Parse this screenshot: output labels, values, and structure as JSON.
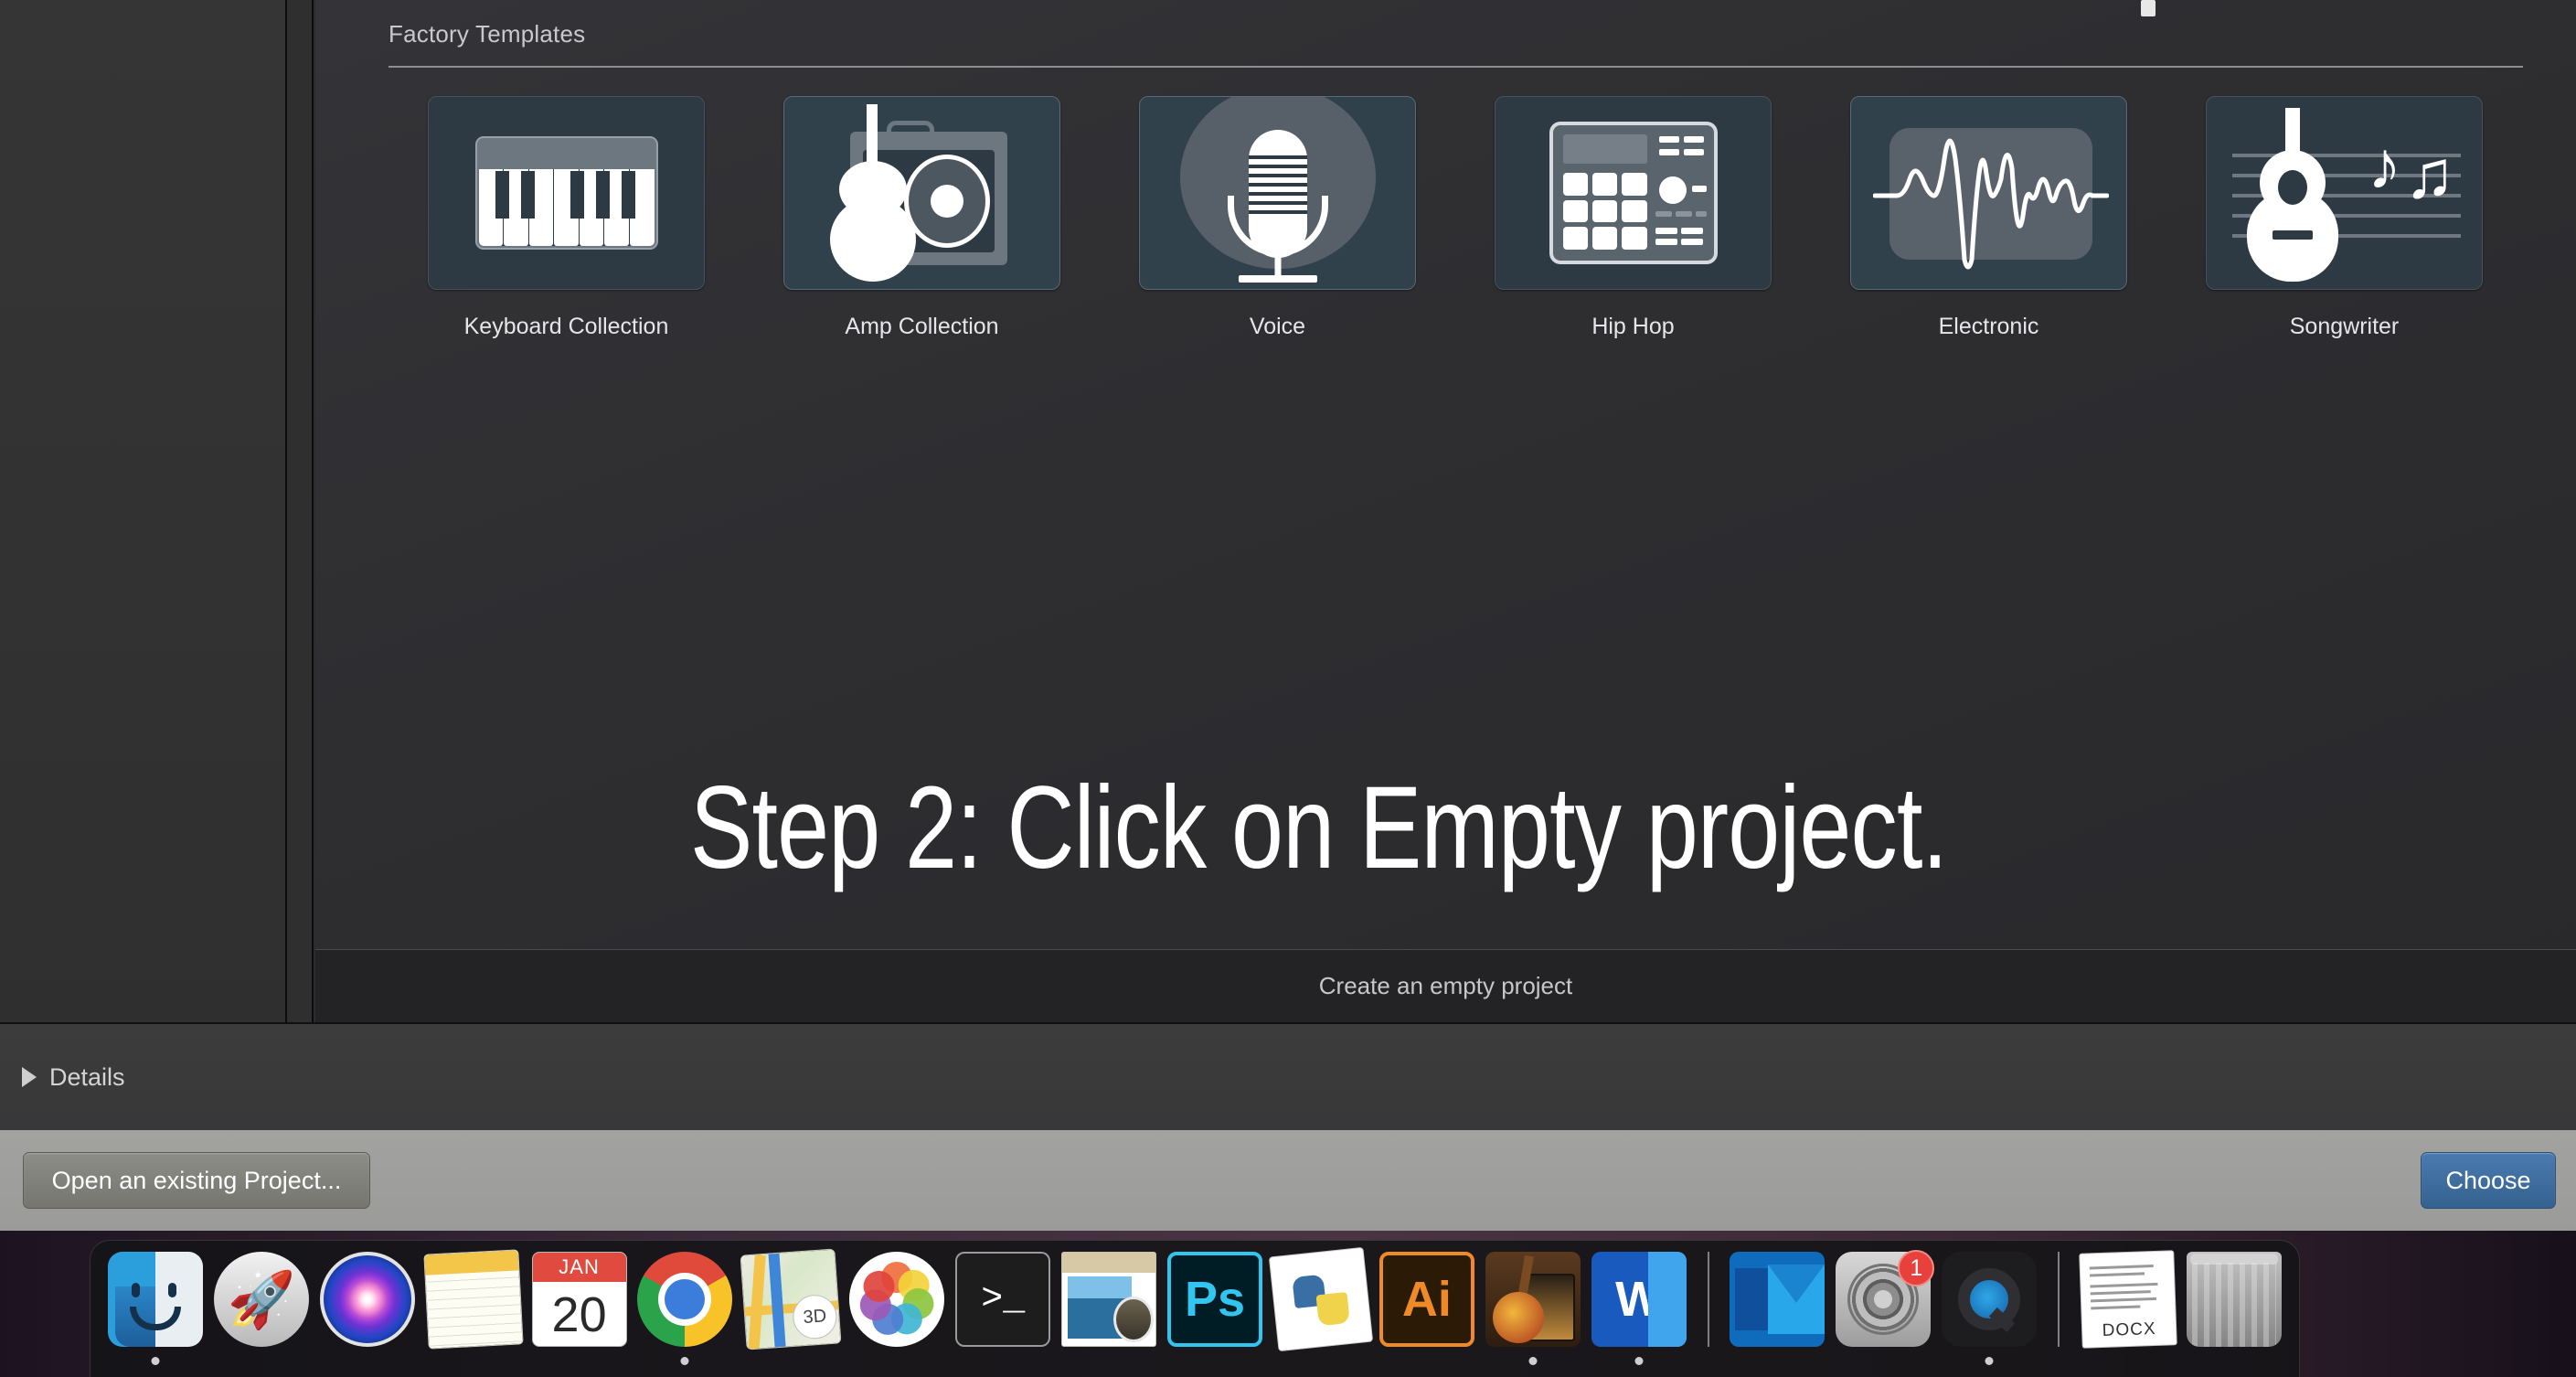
{
  "chooser": {
    "section_title": "Factory Templates",
    "templates": [
      {
        "label": "Keyboard Collection",
        "icon": "piano-keyboard-icon",
        "selected": false
      },
      {
        "label": "Amp Collection",
        "icon": "guitar-amp-icon",
        "selected": false
      },
      {
        "label": "Voice",
        "icon": "microphone-icon",
        "selected": false
      },
      {
        "label": "Hip Hop",
        "icon": "drum-machine-icon",
        "selected": false
      },
      {
        "label": "Electronic",
        "icon": "waveform-icon",
        "selected": false
      },
      {
        "label": "Songwriter",
        "icon": "acoustic-guitar-notes-icon",
        "selected": false
      }
    ],
    "empty_project_label": "Create an empty project",
    "details_label": "Details",
    "details_disclosure": "disclosure-triangle-right-icon",
    "open_existing_label": "Open an existing Project...",
    "choose_label": "Choose"
  },
  "overlay": {
    "step_text": "Step 2: Click on Empty project."
  },
  "dock": {
    "items": [
      {
        "name": "finder",
        "label": "Finder",
        "running": true,
        "badge": ""
      },
      {
        "name": "launchpad",
        "label": "Launchpad",
        "running": false,
        "badge": ""
      },
      {
        "name": "siri",
        "label": "Siri",
        "running": false,
        "badge": ""
      },
      {
        "name": "notes",
        "label": "Notes",
        "running": false,
        "badge": ""
      },
      {
        "name": "calendar",
        "label": "Calendar",
        "running": false,
        "badge": "",
        "month": "JAN",
        "day": "20"
      },
      {
        "name": "chrome",
        "label": "Google Chrome",
        "running": true,
        "badge": ""
      },
      {
        "name": "maps",
        "label": "Maps",
        "running": false,
        "badge": "",
        "overlay": "3D"
      },
      {
        "name": "photos",
        "label": "Photos",
        "running": false,
        "badge": ""
      },
      {
        "name": "terminal",
        "label": "Terminal",
        "running": false,
        "badge": "",
        "glyph": ">_"
      },
      {
        "name": "preview",
        "label": "Preview",
        "running": false,
        "badge": ""
      },
      {
        "name": "photoshop",
        "label": "Adobe Photoshop",
        "running": false,
        "badge": "",
        "glyph": "Ps"
      },
      {
        "name": "python",
        "label": "Python",
        "running": false,
        "badge": ""
      },
      {
        "name": "illustrator",
        "label": "Adobe Illustrator",
        "running": false,
        "badge": "",
        "glyph": "Ai"
      },
      {
        "name": "garageband",
        "label": "GarageBand",
        "running": true,
        "badge": ""
      },
      {
        "name": "word",
        "label": "Microsoft Word",
        "running": true,
        "badge": "",
        "glyph": "W"
      },
      {
        "name": "separator-1",
        "label": "",
        "running": false,
        "badge": ""
      },
      {
        "name": "outlook",
        "label": "Microsoft Outlook",
        "running": false,
        "badge": "",
        "glyph": "O"
      },
      {
        "name": "system-preferences",
        "label": "System Preferences",
        "running": false,
        "badge": "1"
      },
      {
        "name": "quicktime",
        "label": "QuickTime Player",
        "running": true,
        "badge": ""
      },
      {
        "name": "separator-2",
        "label": "",
        "running": false,
        "badge": ""
      },
      {
        "name": "docx-file",
        "label": "DOCX",
        "running": false,
        "badge": "",
        "glyph": "DOCX"
      },
      {
        "name": "trash",
        "label": "Trash",
        "running": false,
        "badge": ""
      }
    ]
  },
  "colors": {
    "tile_bg": "#2d3a44",
    "accent_blue": "#3f6f9f",
    "badge_red": "#e8403a",
    "text_light": "#e6e6ea"
  }
}
